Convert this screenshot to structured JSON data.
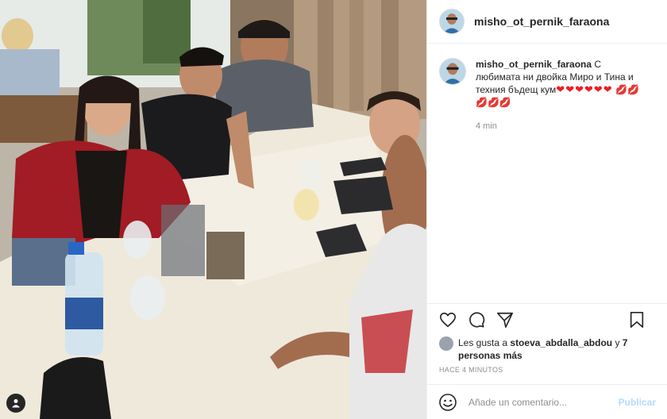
{
  "post": {
    "username": "misho_ot_pernik_faraona",
    "caption_text": "С любимата ни двойка Миро и Тина и техния бъдещ кум",
    "caption_hearts": "❤❤❤❤❤❤",
    "caption_lips": "💋💋💋💋💋",
    "comment_time": "4 min",
    "likes_prefix": "Les gusta a",
    "likes_user": "stoeva_abdalla_abdou",
    "likes_conj": "y",
    "likes_others": "7 personas más",
    "posted_ago": "HACE 4 MINUTOS"
  },
  "comment_box": {
    "placeholder": "Añade un comentario...",
    "publish_label": "Publicar"
  },
  "icons": {
    "like": "heart-icon",
    "comment": "comment-icon",
    "share": "paper-plane-icon",
    "save": "bookmark-icon",
    "emoji": "smiley-icon",
    "tag": "user-tag-icon"
  },
  "colors": {
    "publish_disabled": "#b3dbff",
    "heart": "#ed1c24",
    "border": "#efefef"
  }
}
